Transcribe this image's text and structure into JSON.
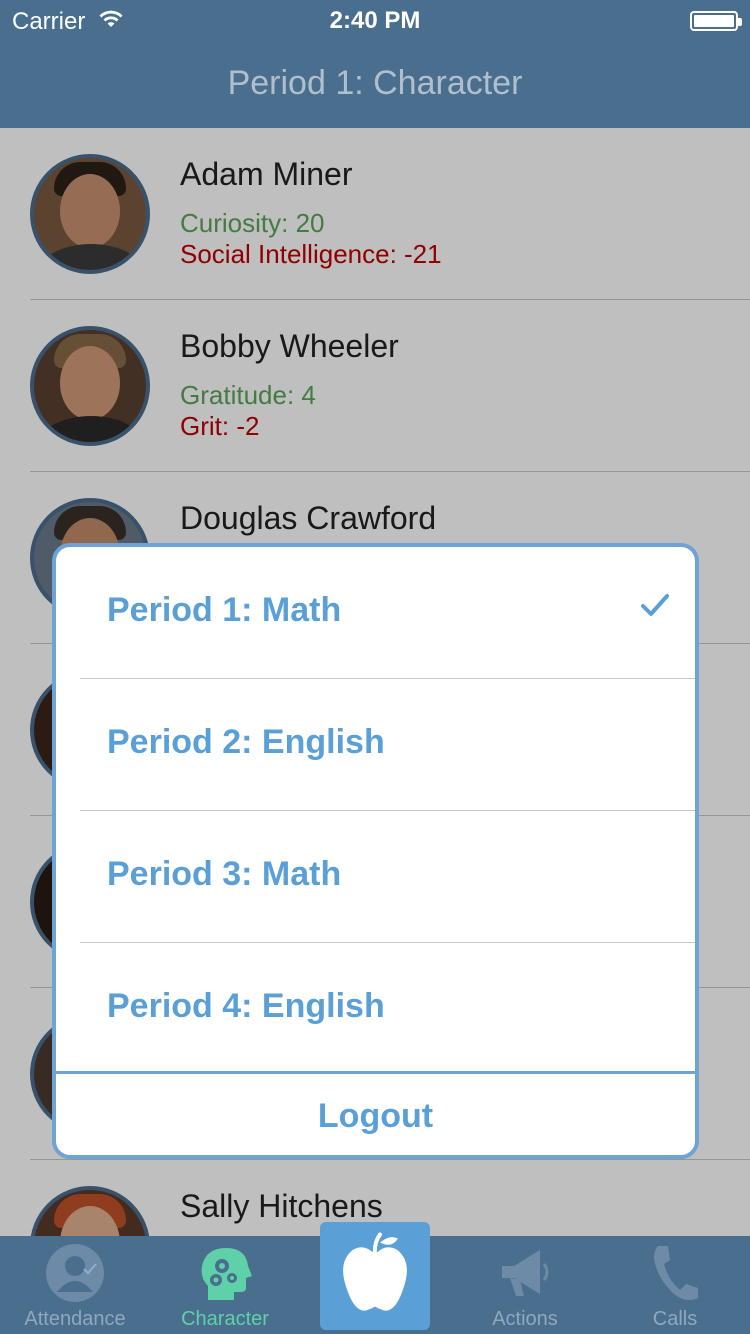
{
  "status_bar": {
    "carrier": "Carrier",
    "time": "2:40 PM"
  },
  "nav": {
    "title": "Period 1: Character"
  },
  "students": [
    {
      "name": "Adam Miner",
      "positive": "Curiosity: 20",
      "negative": "Social Intelligence: -21"
    },
    {
      "name": "Bobby Wheeler",
      "positive": "Gratitude: 4",
      "negative": "Grit: -2"
    },
    {
      "name": "Douglas Crawford",
      "positive": "",
      "negative": ""
    },
    {
      "name": "",
      "positive": "",
      "negative": ""
    },
    {
      "name": "",
      "positive": "",
      "negative": ""
    },
    {
      "name": "",
      "positive": "",
      "negative": ""
    },
    {
      "name": "Sally Hitchens",
      "positive": "",
      "negative": ""
    }
  ],
  "period_menu": {
    "options": [
      {
        "label": "Period 1: Math",
        "selected": true
      },
      {
        "label": "Period 2: English",
        "selected": false
      },
      {
        "label": "Period 3: Math",
        "selected": false
      },
      {
        "label": "Period 4: English",
        "selected": false
      }
    ],
    "logout_label": "Logout"
  },
  "tabs": [
    {
      "label": "Attendance",
      "icon": "person-check-icon",
      "active": false
    },
    {
      "label": "Character",
      "icon": "head-gears-icon",
      "active": true
    },
    {
      "label": "",
      "icon": "apple-icon",
      "active": false
    },
    {
      "label": "Actions",
      "icon": "megaphone-icon",
      "active": false
    },
    {
      "label": "Calls",
      "icon": "phone-icon",
      "active": false
    }
  ],
  "colors": {
    "nav_bar": "#4a6e8e",
    "accent": "#5a9fd6",
    "positive": "#5aa55a",
    "negative": "#c00000",
    "active_tab": "#5fd1a8"
  }
}
